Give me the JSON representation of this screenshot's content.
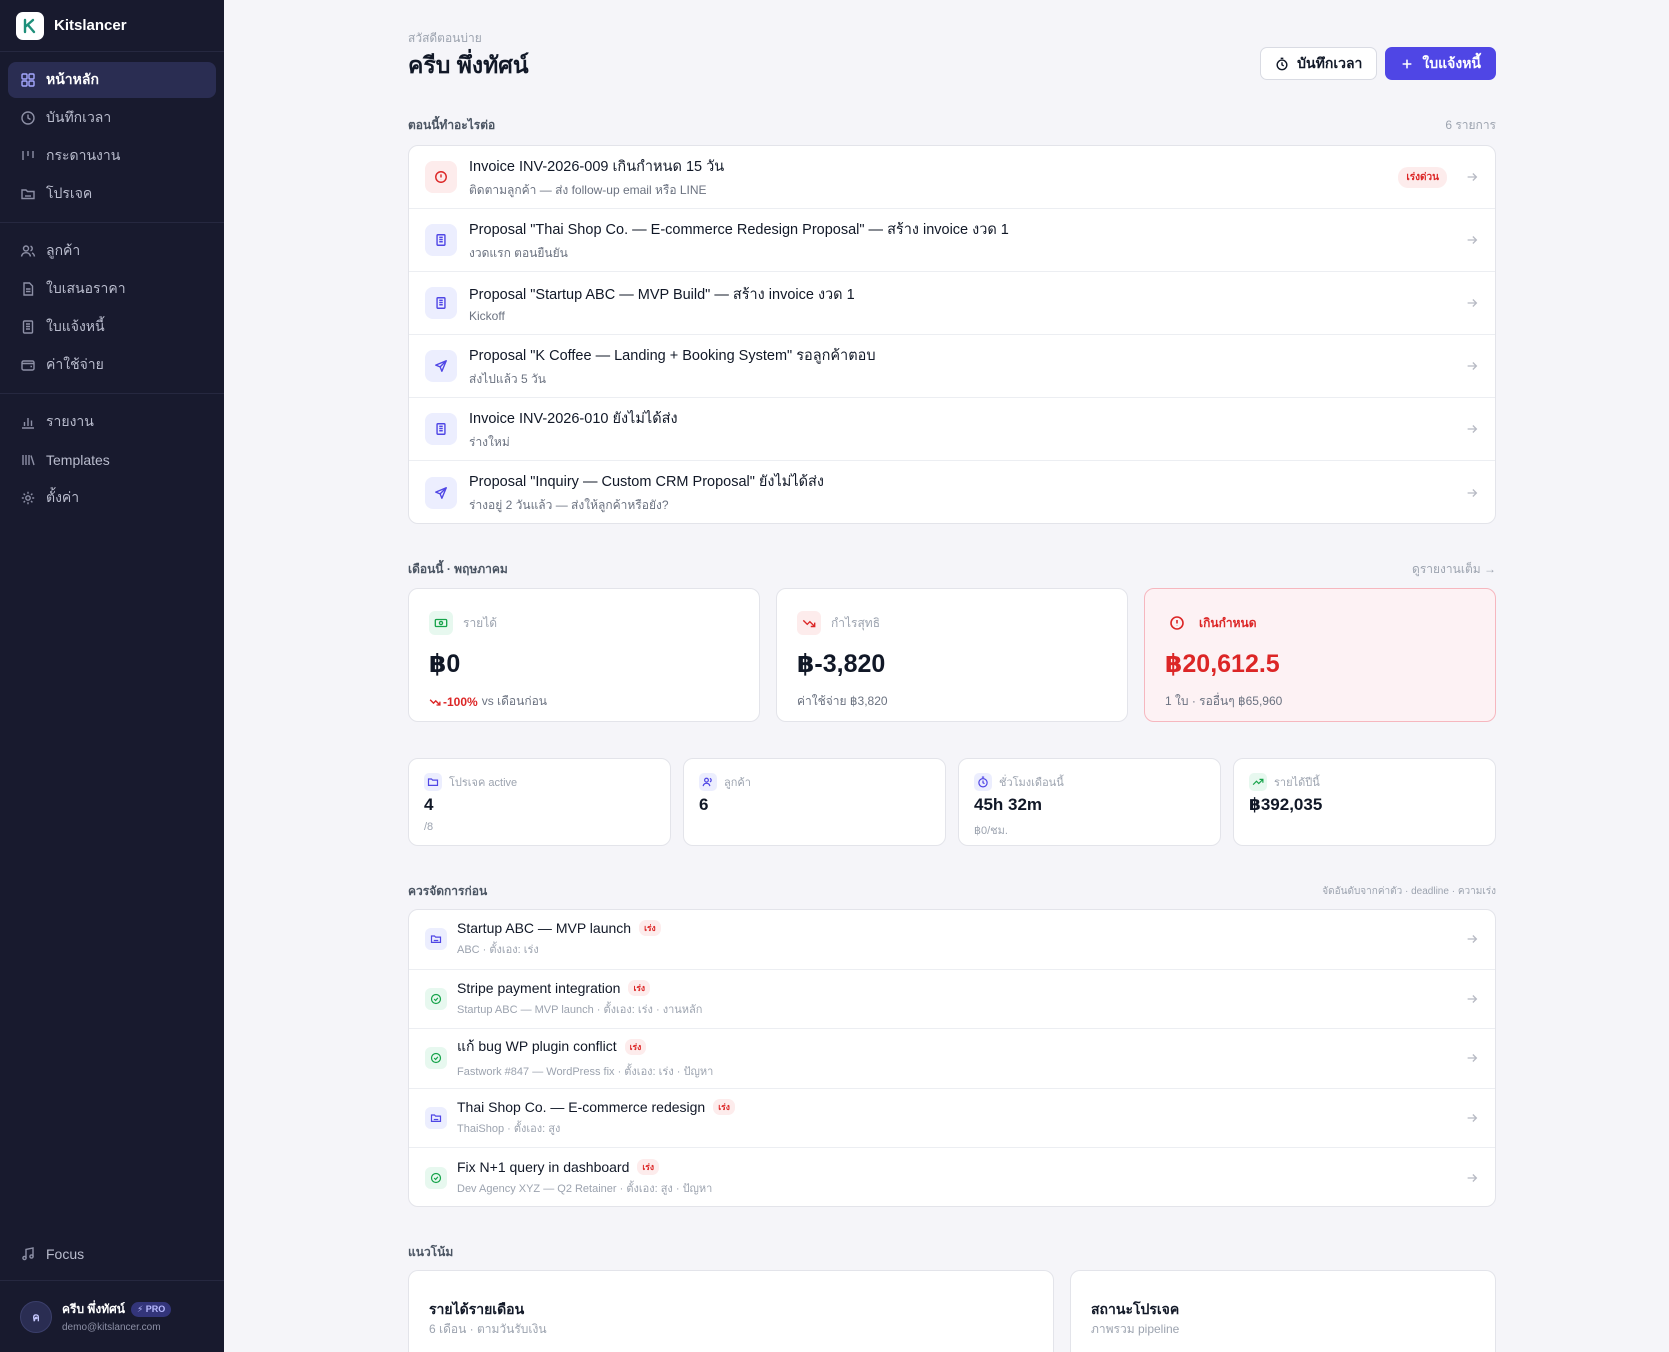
{
  "app": {
    "name": "Kitslancer"
  },
  "sidebar": {
    "groups": [
      [
        {
          "label": "หน้าหลัก",
          "icon": "dashboard-icon",
          "active": true
        },
        {
          "label": "บันทึกเวลา",
          "icon": "clock-icon"
        },
        {
          "label": "กระดานงาน",
          "icon": "kanban-icon"
        },
        {
          "label": "โปรเจค",
          "icon": "folder-icon"
        }
      ],
      [
        {
          "label": "ลูกค้า",
          "icon": "users-icon"
        },
        {
          "label": "ใบเสนอราคา",
          "icon": "document-icon"
        },
        {
          "label": "ใบแจ้งหนี้",
          "icon": "receipt-icon"
        },
        {
          "label": "ค่าใช้จ่าย",
          "icon": "wallet-icon"
        }
      ],
      [
        {
          "label": "รายงาน",
          "icon": "bar-chart-icon"
        },
        {
          "label": "Templates",
          "icon": "library-icon"
        },
        {
          "label": "ตั้งค่า",
          "icon": "gear-icon"
        }
      ]
    ],
    "focus_label": "Focus",
    "user": {
      "initial": "ค",
      "name": "ครีบ พึ่งทัศน์",
      "plan": "PRO",
      "email": "demo@kitslancer.com"
    }
  },
  "header": {
    "greeting": "สวัสดีตอนบ่าย",
    "title": "ครีบ พึ่งทัศน์",
    "log_time_button": "บันทึกเวลา",
    "new_invoice_button": "ใบแจ้งหนี้"
  },
  "next_actions": {
    "title": "ตอนนี้ทำอะไรต่อ",
    "count": "6 รายการ",
    "items": [
      {
        "icon": "alert-icon",
        "tone": "red",
        "title": "Invoice INV-2026-009 เกินกำหนด 15 วัน",
        "subtitle": "ติดตามลูกค้า — ส่ง follow-up email หรือ LINE",
        "badge": "เร่งด่วน"
      },
      {
        "icon": "invoice-icon",
        "tone": "indigo",
        "title": "Proposal \"Thai Shop Co. — E-commerce Redesign Proposal\" — สร้าง invoice งวด 1",
        "subtitle": "งวดแรก ตอนยืนยัน",
        "badge": ""
      },
      {
        "icon": "invoice-icon",
        "tone": "indigo",
        "title": "Proposal \"Startup ABC — MVP Build\" — สร้าง invoice งวด 1",
        "subtitle": "Kickoff",
        "badge": ""
      },
      {
        "icon": "send-icon",
        "tone": "indigo",
        "title": "Proposal \"K Coffee — Landing + Booking System\" รอลูกค้าตอบ",
        "subtitle": "ส่งไปแล้ว 5 วัน",
        "badge": ""
      },
      {
        "icon": "invoice-icon",
        "tone": "indigo",
        "title": "Invoice INV-2026-010 ยังไม่ได้ส่ง",
        "subtitle": "ร่างใหม่",
        "badge": ""
      },
      {
        "icon": "send-icon",
        "tone": "indigo",
        "title": "Proposal \"Inquiry — Custom CRM Proposal\" ยังไม่ได้ส่ง",
        "subtitle": "ร่างอยู่ 2 วันแล้ว — ส่งให้ลูกค้าหรือยัง?",
        "badge": ""
      }
    ]
  },
  "month": {
    "title": "เดือนนี้ · พฤษภาคม",
    "link": "ดูรายงานเต็ม →",
    "revenue": {
      "label": "รายได้",
      "value": "฿0",
      "change": "-100%",
      "change_note": "vs เดือนก่อน"
    },
    "profit": {
      "label": "กำไรสุทธิ",
      "value": "฿-3,820",
      "note": "ค่าใช้จ่าย ฿3,820"
    },
    "overdue": {
      "label": "เกินกำหนด",
      "value": "฿20,612.5",
      "note": "1 ใบ · รออื่นๆ ฿65,960"
    }
  },
  "mini_stats": [
    {
      "icon": "folder-icon",
      "label": "โปรเจค active",
      "value": "4",
      "sub": "/8"
    },
    {
      "icon": "users-icon",
      "label": "ลูกค้า",
      "value": "6",
      "sub": ""
    },
    {
      "icon": "timer-icon",
      "label": "ชั่วโมงเดือนนี้",
      "value": "45h 32m",
      "sub": "฿0/ชม."
    },
    {
      "icon": "trending-up-icon",
      "label": "รายได้ปีนี้",
      "value": "฿392,035",
      "sub": ""
    }
  ],
  "priorities": {
    "title": "ควรจัดการก่อน",
    "meta": "จัดอันดับจากค่าตัว · deadline · ความเร่ง",
    "items": [
      {
        "icon": "folder-icon",
        "tone": "indigo",
        "title": "Startup ABC — MVP launch",
        "badge": "เร่ง",
        "subtitle": "ABC · ตั้งเอง: เร่ง"
      },
      {
        "icon": "check-circle-icon",
        "tone": "green",
        "title": "Stripe payment integration",
        "badge": "เร่ง",
        "subtitle": "Startup ABC — MVP launch · ตั้งเอง: เร่ง · งานหลัก"
      },
      {
        "icon": "check-circle-icon",
        "tone": "green",
        "title": "แก้ bug WP plugin conflict",
        "badge": "เร่ง",
        "subtitle": "Fastwork #847 — WordPress fix · ตั้งเอง: เร่ง · ปัญหา"
      },
      {
        "icon": "folder-icon",
        "tone": "indigo",
        "title": "Thai Shop Co. — E-commerce redesign",
        "badge": "เร่ง",
        "subtitle": "ThaiShop · ตั้งเอง: สูง"
      },
      {
        "icon": "check-circle-icon",
        "tone": "green",
        "title": "Fix N+1 query in dashboard",
        "badge": "เร่ง",
        "subtitle": "Dev Agency XYZ — Q2 Retainer · ตั้งเอง: สูง · ปัญหา"
      }
    ]
  },
  "trends": {
    "title": "แนวโน้ม",
    "monthly": {
      "title": "รายได้รายเดือน",
      "subtitle": "6 เดือน · ตามวันรับเงิน"
    },
    "status": {
      "title": "สถานะโปรเจค",
      "subtitle": "ภาพรวม pipeline"
    }
  },
  "colors": {
    "sidebar_bg": "#181a2e",
    "accent": "#4f46e5",
    "danger": "#dc2626",
    "success": "#16a34a",
    "page_bg": "#f5f5f9"
  }
}
